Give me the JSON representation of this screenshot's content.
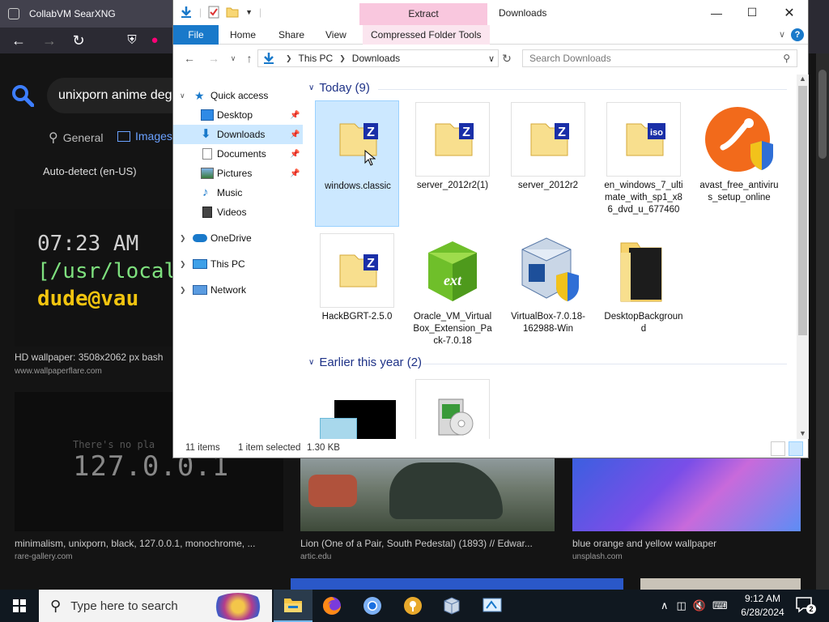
{
  "browser": {
    "tab_title": "CollabVM SearXNG",
    "search_query": "unixporn anime deg",
    "tabs": [
      {
        "label": "General"
      },
      {
        "label": "Images"
      }
    ],
    "language": "Auto-detect (en-US)",
    "results": [
      {
        "caption": "HD wallpaper: 3508x2062 px bash",
        "source": "www.wallpaperflare.com",
        "terminal": {
          "time": "07:23 AM",
          "path": "[/usr/local/s",
          "prompt": "dude@vau"
        }
      },
      {
        "caption": "minimalism, unixporn, black, 127.0.0.1, monochrome, ...",
        "source": "rare-gallery.com",
        "overlay_top": "There's no pla",
        "overlay_ip": "127.0.0.1"
      },
      {
        "caption": "Lion (One of a Pair, South Pedestal) (1893) // Edwar...",
        "source": "artic.edu"
      },
      {
        "caption": "blue orange and yellow wallpaper",
        "source": "unsplash.com"
      }
    ]
  },
  "explorer": {
    "title": "Downloads",
    "context_tab": "Extract",
    "ribbon_tabs": [
      "File",
      "Home",
      "Share",
      "View",
      "Compressed Folder Tools"
    ],
    "address": [
      "This PC",
      "Downloads"
    ],
    "search_placeholder": "Search Downloads",
    "nav": [
      {
        "label": "Quick access",
        "icon": "star-icon"
      },
      {
        "label": "Desktop",
        "icon": "desktop-icon",
        "pinned": true
      },
      {
        "label": "Downloads",
        "icon": "download-icon",
        "pinned": true,
        "selected": true
      },
      {
        "label": "Documents",
        "icon": "document-icon",
        "pinned": true
      },
      {
        "label": "Pictures",
        "icon": "pictures-icon",
        "pinned": true
      },
      {
        "label": "Music",
        "icon": "music-icon"
      },
      {
        "label": "Videos",
        "icon": "videos-icon"
      },
      {
        "label": "OneDrive",
        "icon": "cloud-icon"
      },
      {
        "label": "This PC",
        "icon": "pc-icon"
      },
      {
        "label": "Network",
        "icon": "network-icon"
      }
    ],
    "groups": [
      {
        "label": "Today (9)"
      },
      {
        "label": "Earlier this year (2)"
      }
    ],
    "files": [
      {
        "name": "windows.classic",
        "type": "zip",
        "selected": true
      },
      {
        "name": "server_2012r2(1)",
        "type": "zip"
      },
      {
        "name": "server_2012r2",
        "type": "zip"
      },
      {
        "name": "en_windows_7_ultimate_with_sp1_x86_dvd_u_677460",
        "type": "iso"
      },
      {
        "name": "avast_free_antivirus_setup_online",
        "type": "avast"
      },
      {
        "name": "HackBGRT-2.5.0",
        "type": "zip"
      },
      {
        "name": "Oracle_VM_VirtualBox_Extension_Pack-7.0.18",
        "type": "ext"
      },
      {
        "name": "VirtualBox-7.0.18-162988-Win",
        "type": "vbox"
      },
      {
        "name": "DesktopBackground",
        "type": "folder"
      }
    ],
    "status": {
      "count": "11 items",
      "selection": "1 item selected",
      "size": "1.30 KB"
    }
  },
  "taskbar": {
    "search_placeholder": "Type here to search",
    "time": "9:12 AM",
    "date": "6/28/2024",
    "notification_count": "2"
  }
}
